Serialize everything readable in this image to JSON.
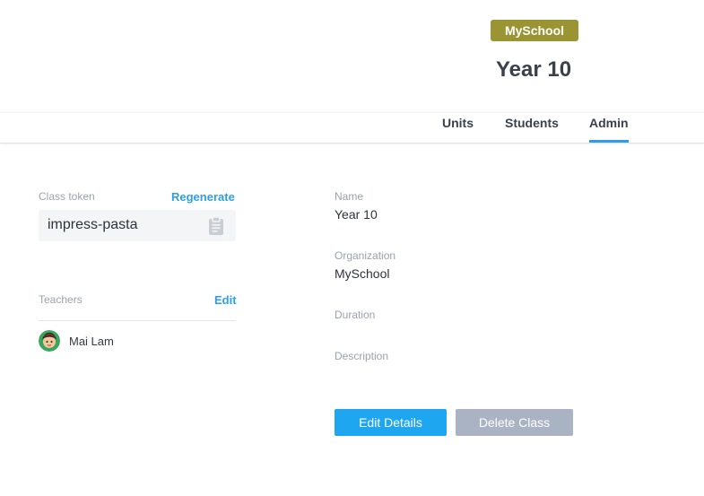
{
  "header": {
    "org_badge": "MySchool",
    "class_title": "Year 10",
    "badge_color": "#9b9432"
  },
  "tabs": [
    {
      "label": "Units",
      "active": false
    },
    {
      "label": "Students",
      "active": false
    },
    {
      "label": "Admin",
      "active": true
    }
  ],
  "token": {
    "label": "Class token",
    "regenerate_label": "Regenerate",
    "value": "impress-pasta",
    "copy_icon": "clipboard-icon"
  },
  "teachers": {
    "label": "Teachers",
    "edit_label": "Edit",
    "items": [
      {
        "name": "Mai Lam",
        "avatar_icon": "avatar"
      }
    ]
  },
  "details": {
    "name_label": "Name",
    "name_value": "Year 10",
    "organization_label": "Organization",
    "organization_value": "MySchool",
    "duration_label": "Duration",
    "duration_value": "",
    "description_label": "Description",
    "description_value": ""
  },
  "actions": {
    "edit_details_label": "Edit Details",
    "delete_class_label": "Delete Class"
  },
  "colors": {
    "accent": "#2f9ee6",
    "primary_button": "#1ea7f0",
    "disabled_button": "#aab3c4"
  }
}
